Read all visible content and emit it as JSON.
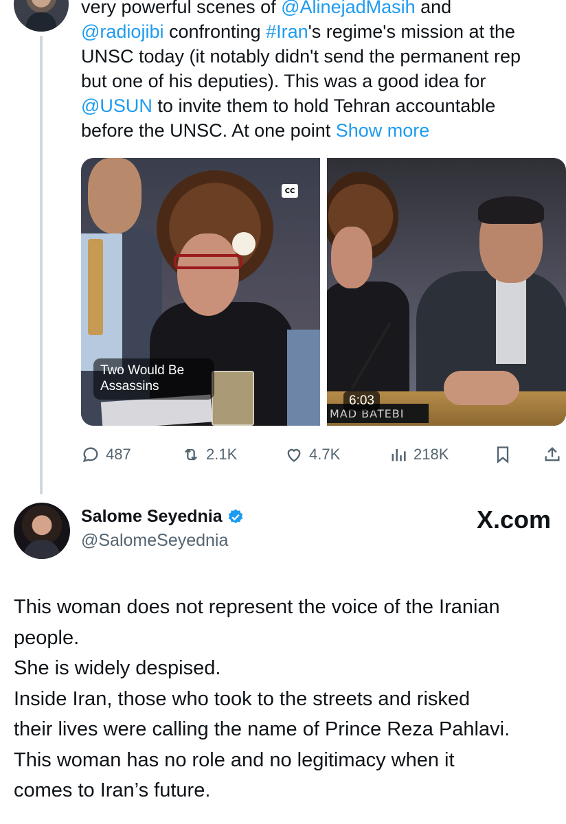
{
  "tweet": {
    "lines": [
      {
        "segments": [
          {
            "text": "very powerful scenes of ",
            "link": false
          },
          {
            "text": "@AlinejadMasih",
            "link": true
          },
          {
            "text": " and",
            "link": false
          }
        ]
      },
      {
        "segments": [
          {
            "text": "@radiojibi",
            "link": true
          },
          {
            "text": " confronting ",
            "link": false
          },
          {
            "text": "#Iran",
            "link": true
          },
          {
            "text": "'s regime's mission at the",
            "link": false
          }
        ]
      },
      {
        "segments": [
          {
            "text": "UNSC today (it notably didn't send the permanent rep",
            "link": false
          }
        ]
      },
      {
        "segments": [
          {
            "text": "but one of his deputies). This was a good idea for",
            "link": false
          }
        ]
      },
      {
        "segments": [
          {
            "text": "@USUN",
            "link": true
          },
          {
            "text": " to invite them to hold Tehran accountable",
            "link": false
          }
        ]
      },
      {
        "segments": [
          {
            "text": "before the UNSC. At one point ",
            "link": false
          },
          {
            "text": "Show more",
            "link": true
          }
        ]
      }
    ],
    "link_color": "#1d9bf0"
  },
  "media": {
    "left": {
      "cc_label": "CC",
      "caption": "Two Would Be Assassins"
    },
    "right": {
      "nameplate": "MAD BATEBI",
      "duration": "6:03"
    }
  },
  "actions": {
    "replies": {
      "icon": "reply-icon",
      "count": "487"
    },
    "reposts": {
      "icon": "repost-icon",
      "count": "2.1K"
    },
    "likes": {
      "icon": "like-icon",
      "count": "4.7K"
    },
    "views": {
      "icon": "views-icon",
      "count": "218K"
    },
    "bookmark": {
      "icon": "bookmark-icon"
    },
    "share": {
      "icon": "share-icon"
    }
  },
  "reply": {
    "author_name": "Salome Seyednia",
    "author_handle": "@SalomeSeyednia",
    "verified_color": "#1d9bf0",
    "watermark": "X.com",
    "lines": [
      "This woman does not represent the voice of the Iranian",
      "people.",
      "She is widely despised.",
      "Inside Iran, those who took to the streets and risked",
      "their lives were calling the name of Prince Reza Pahlavi.",
      "This woman has no role and no legitimacy when it",
      "comes to Iran’s future."
    ]
  }
}
